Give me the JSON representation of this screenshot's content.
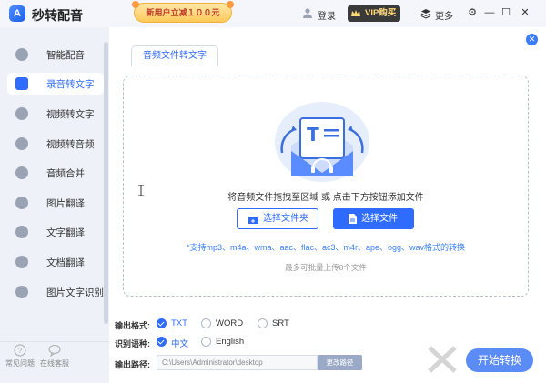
{
  "app": {
    "name": "秒转配音",
    "logo_glyph": "A"
  },
  "header": {
    "promo": "新用户立减１００元",
    "login": "登录",
    "vip": "VIP购买",
    "more": "更多",
    "win_controls": {
      "settings": "⚙",
      "minimize": "—",
      "maximize": "☐",
      "close": "✕"
    }
  },
  "sidebar": {
    "items": [
      {
        "label": "智能配音",
        "icon": "mic-icon",
        "active": false
      },
      {
        "label": "录音转文字",
        "icon": "ai-icon",
        "active": true
      },
      {
        "label": "视频转文字",
        "icon": "video-icon",
        "active": false
      },
      {
        "label": "视频转音频",
        "icon": "video-audio-icon",
        "active": false
      },
      {
        "label": "音频合并",
        "icon": "merge-icon",
        "active": false
      },
      {
        "label": "图片翻译",
        "icon": "image-icon",
        "active": false
      },
      {
        "label": "文字翻译",
        "icon": "translate-icon",
        "active": false
      },
      {
        "label": "文档翻译",
        "icon": "doc-icon",
        "active": false
      },
      {
        "label": "图片文字识别",
        "icon": "ocr-icon",
        "active": false
      }
    ],
    "help": "常见问题",
    "service": "在线客服"
  },
  "main": {
    "tab": "音频文件转文字",
    "drop_hint": "将音频文件拖拽至区域 或 点击下方按钮添加文件",
    "select_folder": "选择文件夹",
    "select_file": "选择文件",
    "formats": "*支持mp3、m4a、wma、aac、flac、ac3、m4r、ape、ogg、wav格式的转换",
    "limit": "最多可批量上传8个文件"
  },
  "settings": {
    "output_format_label": "输出格式:",
    "output_formats": [
      "TXT",
      "WORD",
      "SRT"
    ],
    "selected_format": "TXT",
    "language_label": "识别语种:",
    "languages": [
      "中文",
      "English"
    ],
    "selected_language": "中文",
    "path_label": "输出路径:",
    "path_value": "C:\\Users\\Administrator\\desktop",
    "change_path": "更改路径"
  },
  "start_button": "开始转换",
  "colors": {
    "accent": "#2f6bff",
    "sidebar_bg": "#eef2f8",
    "vip_text": "#ffd978"
  }
}
